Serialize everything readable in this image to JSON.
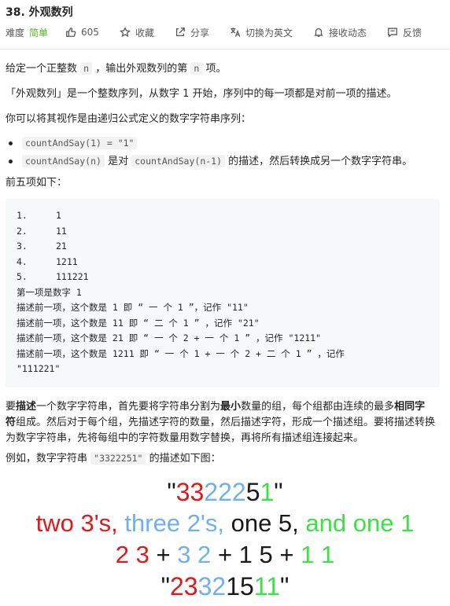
{
  "problem": {
    "title": "38. 外观数列",
    "difficulty_label": "难度",
    "difficulty": "简单",
    "likes": "605",
    "collect": "收藏",
    "share": "分享",
    "switch_lang": "切换为英文",
    "notify": "接收动态",
    "feedback": "反馈"
  },
  "desc": {
    "p1_a": "给定一个正整数",
    "p1_code": "n",
    "p1_b": "，输出外观数列的第",
    "p1_code2": "n",
    "p1_c": "项。",
    "p2": "「外观数列」是一个整数序列，从数字 1 开始，序列中的每一项都是对前一项的描述。",
    "p3": "你可以将其视作是由递归公式定义的数字字符串序列：",
    "bullet1_code": "countAndSay(1) = \"1\"",
    "bullet2_code": "countAndSay(n)",
    "bullet2_a": "是对",
    "bullet2_code2": "countAndSay(n-1)",
    "bullet2_b": "的描述，然后转换成另一个数字字符串。",
    "p4": "前五项如下：",
    "p5_a": "要",
    "p5_b1": "描述",
    "p5_c": "一个数字字符串，首先要将字符串分割为",
    "p5_b2": "最小",
    "p5_d": "数量的组，每个组都由连续的最多",
    "p5_b3": "相同字",
    "p5_b4": "符",
    "p5_e": "组成。然后对于每个组，先描述字符的数量，然后描述字符，形成一个描述组。要将描述转换",
    "p5_f": "为数字字符串，先将每组中的字符数量用数字替换，再将所有描述组连接起来。",
    "p6_a": "例如，数字字符串",
    "p6_code": "\"3322251\"",
    "p6_b": "的描述如下图："
  },
  "sequence": [
    {
      "n": "1.",
      "v": "1"
    },
    {
      "n": "2.",
      "v": "11"
    },
    {
      "n": "3.",
      "v": "21"
    },
    {
      "n": "4.",
      "v": "1211"
    },
    {
      "n": "5.",
      "v": "111221"
    }
  ],
  "explain": [
    "第一项是数字 1",
    "描述前一项，这个数是 1 即 “ 一 个 1 ”，记作 \"11\"",
    "描述前一项，这个数是 11 即 “ 二 个 1 ” ，记作 \"21\"",
    "描述前一项，这个数是 21 即 “ 一 个 2 + 一 个 1 ” ，记作 \"1211\"",
    "描述前一项，这个数是 1211 即 “ 一 个 1 + 一 个 2 + 二 个 1 ” ，记作",
    "\"111221\""
  ],
  "figure": {
    "q_open": "\"",
    "r1": "33",
    "b1": "222",
    "k1": "5",
    "g1": "1",
    "q_close": "\"",
    "l2_r": "two 3's,",
    "l2_b": "three 2's,",
    "l2_k": "one 5,",
    "l2_g": "and one 1",
    "l3_r": "2 3",
    "l3_p1": "+",
    "l3_b": "3 2",
    "l3_p2": "+",
    "l3_k": "1 5",
    "l3_p3": "+",
    "l3_g": "1 1",
    "l4_r": "23",
    "l4_b": "32",
    "l4_k": "15",
    "l4_g": "11"
  },
  "colors": {
    "easy": "#5ab726",
    "red": "#e0191d",
    "blue": "#6fb1ea",
    "green": "#3de046"
  }
}
